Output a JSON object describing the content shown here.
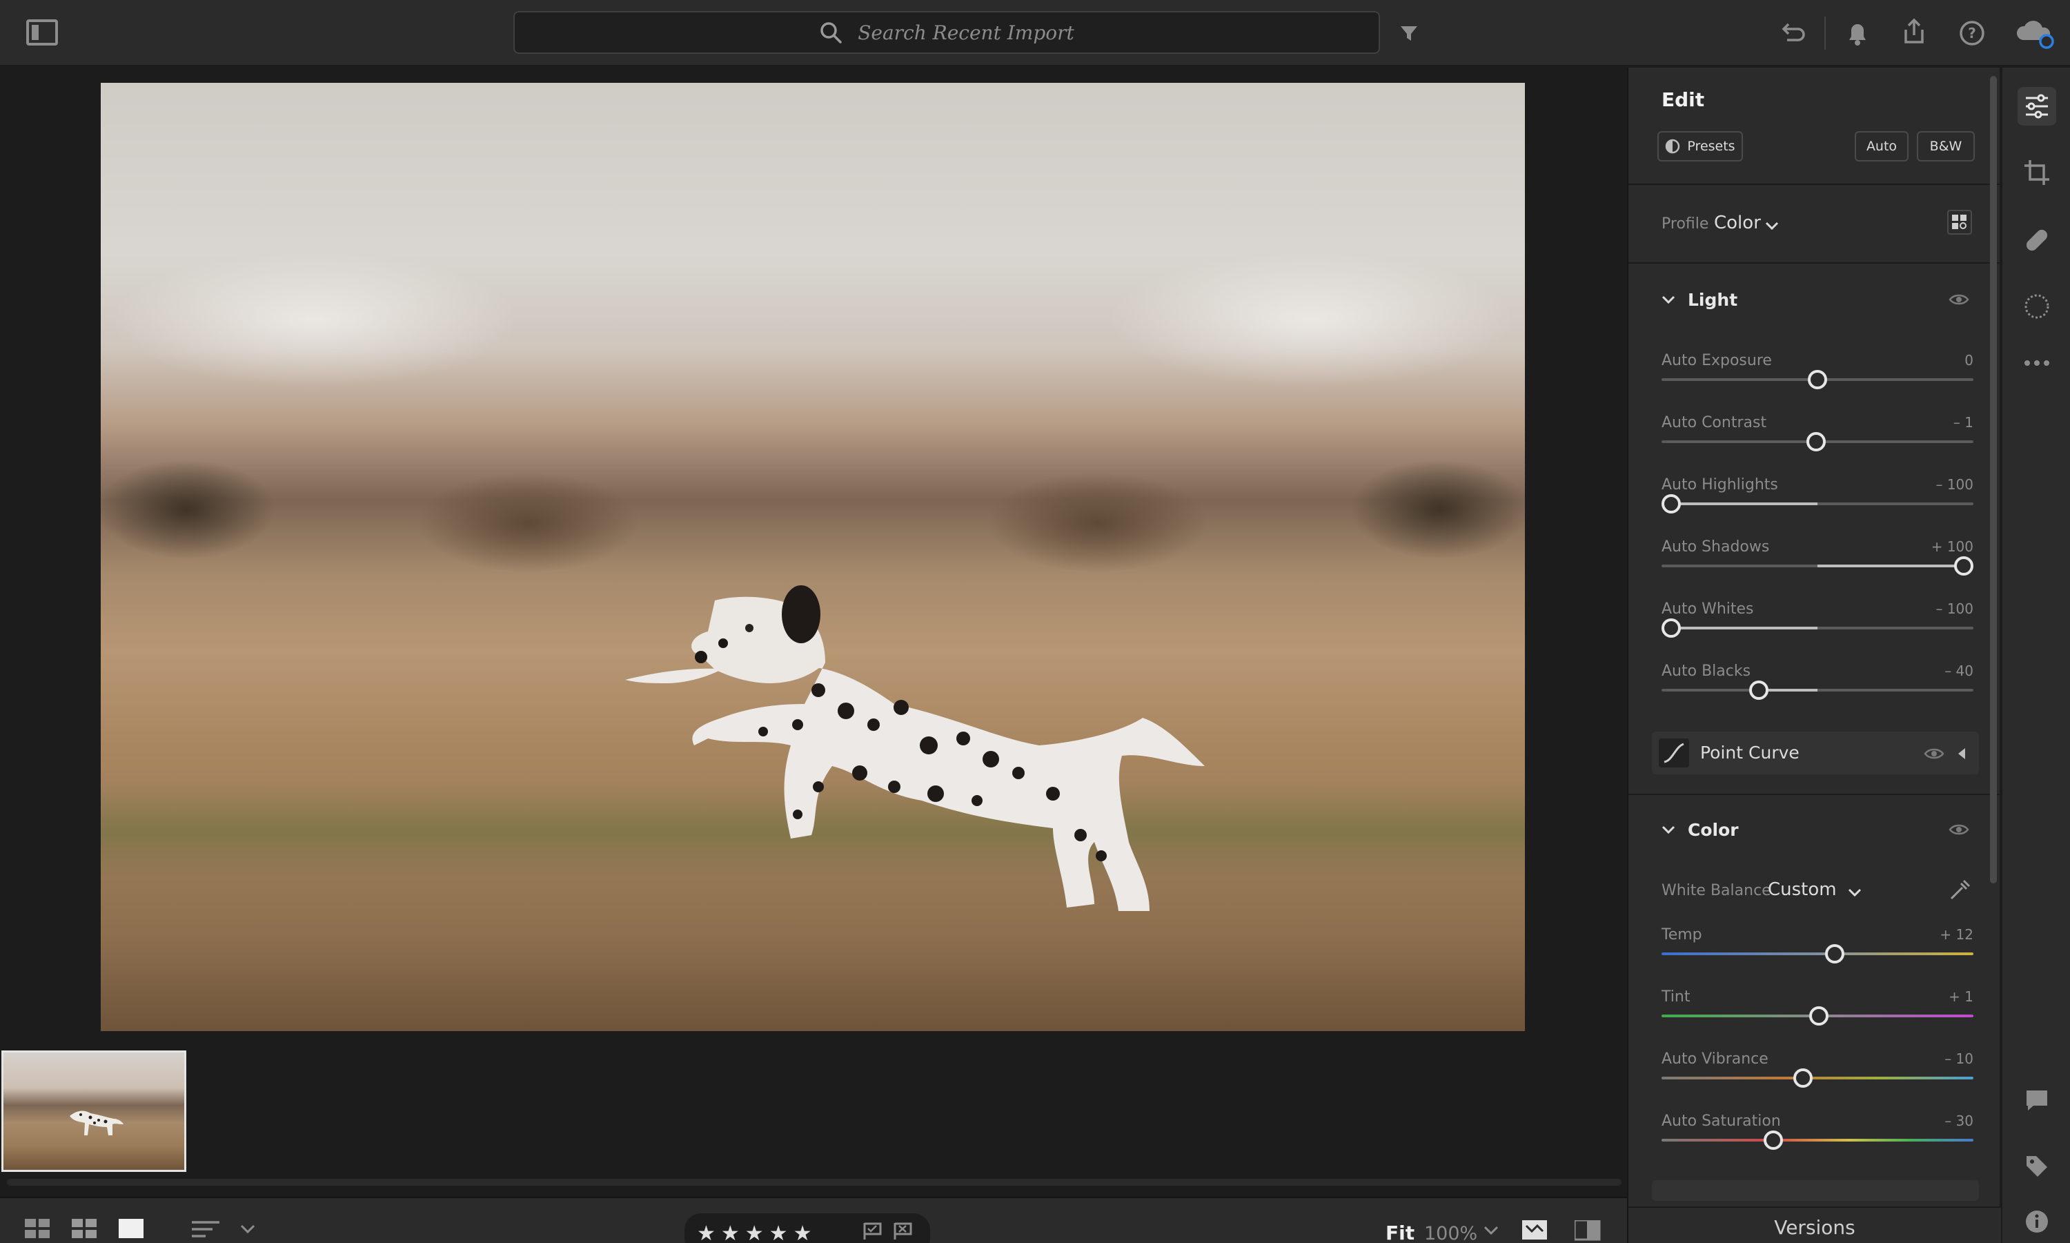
{
  "topbar": {
    "search_placeholder": "Search Recent Import"
  },
  "edit": {
    "title": "Edit",
    "presets_label": "Presets",
    "auto_label": "Auto",
    "bw_label": "B&W",
    "profile_label": "Profile",
    "profile_value": "Color",
    "light": {
      "title": "Light",
      "sliders": [
        {
          "label": "Auto Exposure",
          "value": "0",
          "pos": 0.5
        },
        {
          "label": "Auto Contrast",
          "value": "– 1",
          "pos": 0.495
        },
        {
          "label": "Auto Highlights",
          "value": "– 100",
          "pos": 0.0
        },
        {
          "label": "Auto Shadows",
          "value": "+ 100",
          "pos": 1.0
        },
        {
          "label": "Auto Whites",
          "value": "– 100",
          "pos": 0.0
        },
        {
          "label": "Auto Blacks",
          "value": "– 40",
          "pos": 0.3
        }
      ]
    },
    "point_curve_label": "Point Curve",
    "color": {
      "title": "Color",
      "white_balance_label": "White Balance",
      "white_balance_value": "Custom",
      "sliders": [
        {
          "label": "Temp",
          "value": "+ 12",
          "pos": 0.56
        },
        {
          "label": "Tint",
          "value": "+ 1",
          "pos": 0.505
        },
        {
          "label": "Auto Vibrance",
          "value": "– 10",
          "pos": 0.45
        },
        {
          "label": "Auto Saturation",
          "value": "– 30",
          "pos": 0.35
        }
      ]
    },
    "versions_label": "Versions"
  },
  "bottombar": {
    "fit_label": "Fit",
    "zoom_label": "100%",
    "stars": "★★★★★"
  },
  "colors": {
    "panel_bg": "#2b2b2b",
    "canvas_bg": "#1c1c1c",
    "accent_blue": "#2d7fe0"
  }
}
